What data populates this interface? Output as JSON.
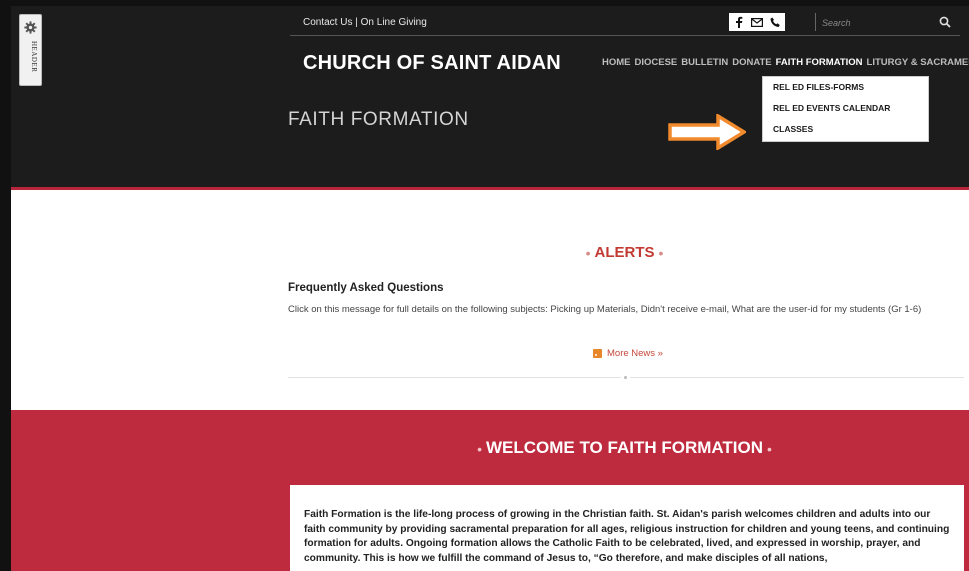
{
  "side_tab": {
    "label": "HEADER",
    "icon": "gear-icon"
  },
  "topbar": {
    "contact_link": "Contact Us",
    "separator": "|",
    "giving_link": "On Line Giving",
    "social_icons": [
      "facebook-icon",
      "email-icon",
      "phone-icon"
    ],
    "search_placeholder": "Search"
  },
  "site_title": "CHURCH OF SAINT AIDAN",
  "nav": {
    "items": [
      {
        "label": "HOME",
        "active": false
      },
      {
        "label": "DIOCESE",
        "active": false
      },
      {
        "label": "BULLETIN",
        "active": false
      },
      {
        "label": "DONATE",
        "active": false
      },
      {
        "label": "FAITH FORMATION",
        "active": true
      },
      {
        "label": "LITURGY & SACRAMENTS",
        "active": false
      }
    ],
    "dropdown": [
      "REL ED FILES-FORMS",
      "REL ED EVENTS CALENDAR",
      "CLASSES"
    ]
  },
  "page_title": "FAITH FORMATION",
  "alerts": {
    "heading": "ALERTS",
    "faq_title": "Frequently Asked Questions",
    "faq_body": "Click on this message for full details on the following subjects: Picking up Materials, Didn't receive e-mail, What are the user-id for my students (Gr 1-6)",
    "more_news": "More News »"
  },
  "welcome": {
    "heading": "WELCOME TO FAITH FORMATION",
    "body": "Faith Formation is the life-long process of growing in the Christian faith.  St. Aidan's parish welcomes children and adults into our faith community by providing sacramental preparation for all ages, religious instruction for children and young teens, and continuing formation for adults.  Ongoing formation allows the Catholic Faith to be celebrated, lived, and expressed in worship, prayer, and community.  This is how we fulfill the command of Jesus to, “Go therefore, and make disciples of all nations,"
  },
  "colors": {
    "header_bg": "#1c1c1c",
    "accent_red": "#bf2b3e",
    "alert_red": "#c23a33",
    "arrow_orange": "#f08a2c"
  }
}
